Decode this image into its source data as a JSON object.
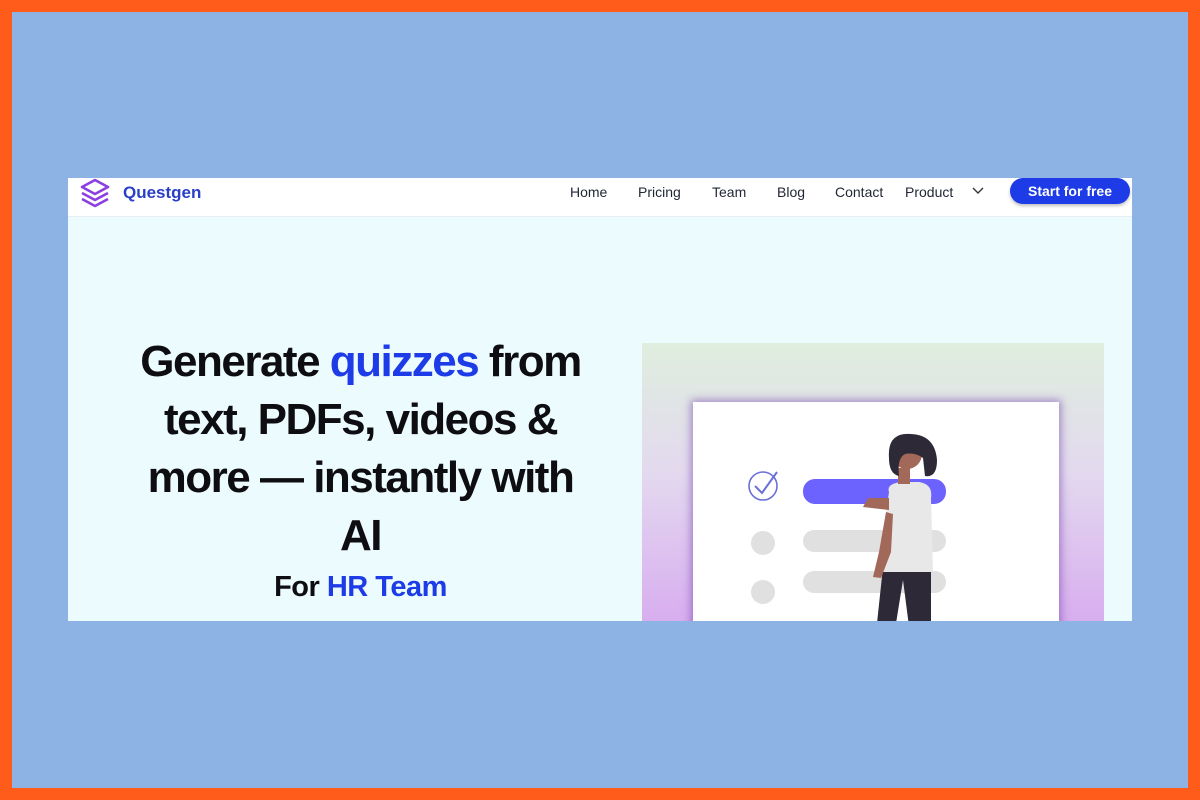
{
  "brand": {
    "name": "Questgen",
    "logo_icon": "layers-stack-icon"
  },
  "nav": {
    "links": [
      "Home",
      "Pricing",
      "Team",
      "Blog",
      "Contact",
      "Product"
    ],
    "product_dropdown_icon": "chevron-down-icon",
    "cta_label": "Start for free"
  },
  "hero": {
    "line1_pre": "Generate ",
    "line1_highlight": "quizzes",
    "line1_post": " from",
    "line2": "text, PDFs, videos &",
    "line3": "more — instantly with",
    "line4": "AI",
    "sub_pre": "For ",
    "sub_highlight": "HR Team"
  },
  "illustration": {
    "subject": "person-with-checklist",
    "check_icon": "check-circle-icon"
  },
  "colors": {
    "accent": "#1d3ce8",
    "brand_text": "#2a3fc8",
    "logo_purple": "#8b3fe0",
    "outer_border": "#ff5c1c",
    "outer_bg": "#8db3e4",
    "page_bg": "#ecfbfd"
  }
}
